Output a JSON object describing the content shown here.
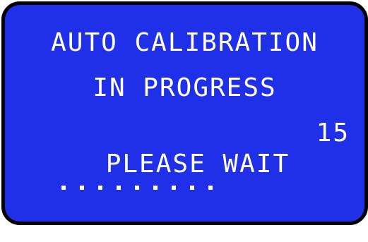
{
  "display": {
    "line1": "AUTO CALIBRATION",
    "line2": "IN PROGRESS",
    "line3_label": "PLEASE WAIT",
    "countdown": "15",
    "progress_dots": 9,
    "background_color": "#1f30e8",
    "text_color": "#ffffff"
  }
}
